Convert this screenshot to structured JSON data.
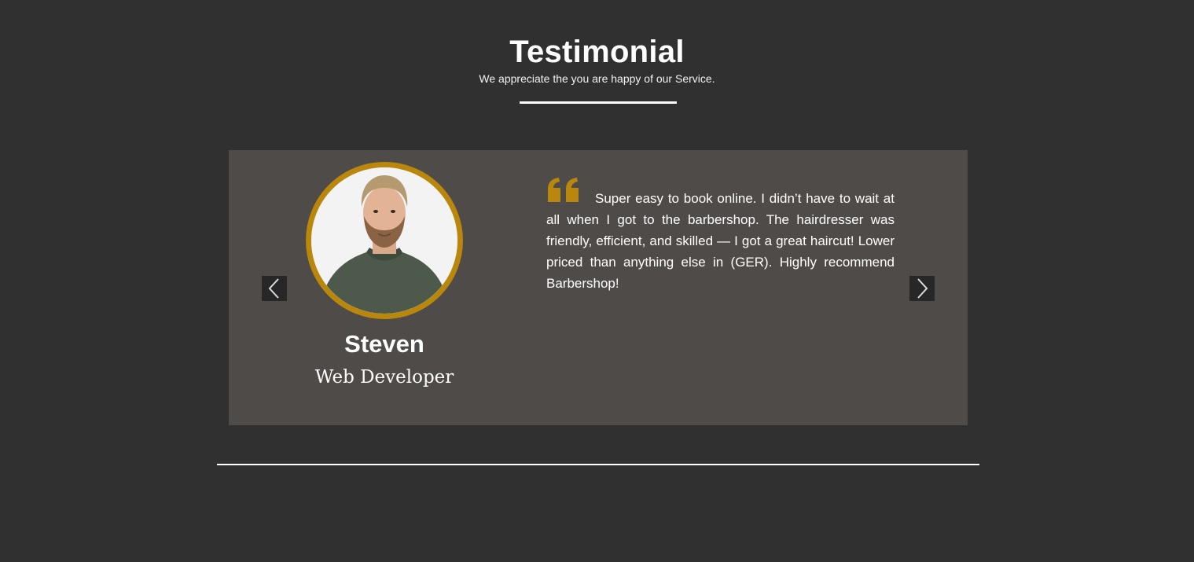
{
  "header": {
    "title": "Testimonial",
    "subtitle": "We appreciate the you are happy of our Service."
  },
  "testimonial": {
    "name": "Steven",
    "role": "Web Developer",
    "quote": "Super easy to book online. I didn’t have to wait at all when I got to the barbershop. The hairdresser was friendly, efficient, and skilled — I got a great haircut! Lower priced than anything else in (GER). Highly recommend Barbershop!",
    "avatar_icon": "person-photo",
    "quote_icon": "quote-mark-icon"
  },
  "nav": {
    "prev_icon": "chevron-left-icon",
    "next_icon": "chevron-right-icon"
  },
  "colors": {
    "page_bg": "#303030",
    "card_bg": "#4f4b49",
    "accent": "#b8870b",
    "nav_bg": "#272727",
    "text": "#ffffff"
  }
}
